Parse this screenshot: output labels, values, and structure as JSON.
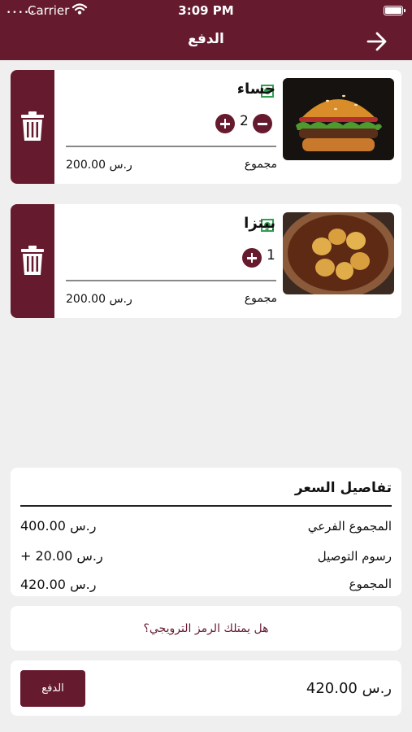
{
  "status_bar": {
    "carrier": "Carrier",
    "time": "3:09 PM"
  },
  "header": {
    "title": "الدفع"
  },
  "cart": {
    "items": [
      {
        "name": "حساء",
        "quantity": "2",
        "total_label": "مجموع",
        "total_value": "ر.س 200.00",
        "image": "burger"
      },
      {
        "name": "بيتزا",
        "quantity": "1",
        "total_label": "مجموع",
        "total_value": "ر.س 200.00",
        "image": "curry-dish"
      }
    ]
  },
  "price_details": {
    "title": "تفاصيل السعر",
    "rows": [
      {
        "label": "المجموع الفرعي",
        "value": "ر.س 400.00"
      },
      {
        "label": "رسوم التوصيل",
        "value": "+ ر.س 20.00"
      },
      {
        "label": "المجموع",
        "value": "ر.س 420.00"
      }
    ]
  },
  "promo": {
    "text": "هل يمتلك الرمز الترويجي؟"
  },
  "checkout": {
    "amount": "ر.س 420.00",
    "pay_label": "الدفع"
  },
  "colors": {
    "brand": "#661a2e",
    "veg_indicator": "#2f9f4f",
    "background": "#efeff0"
  }
}
